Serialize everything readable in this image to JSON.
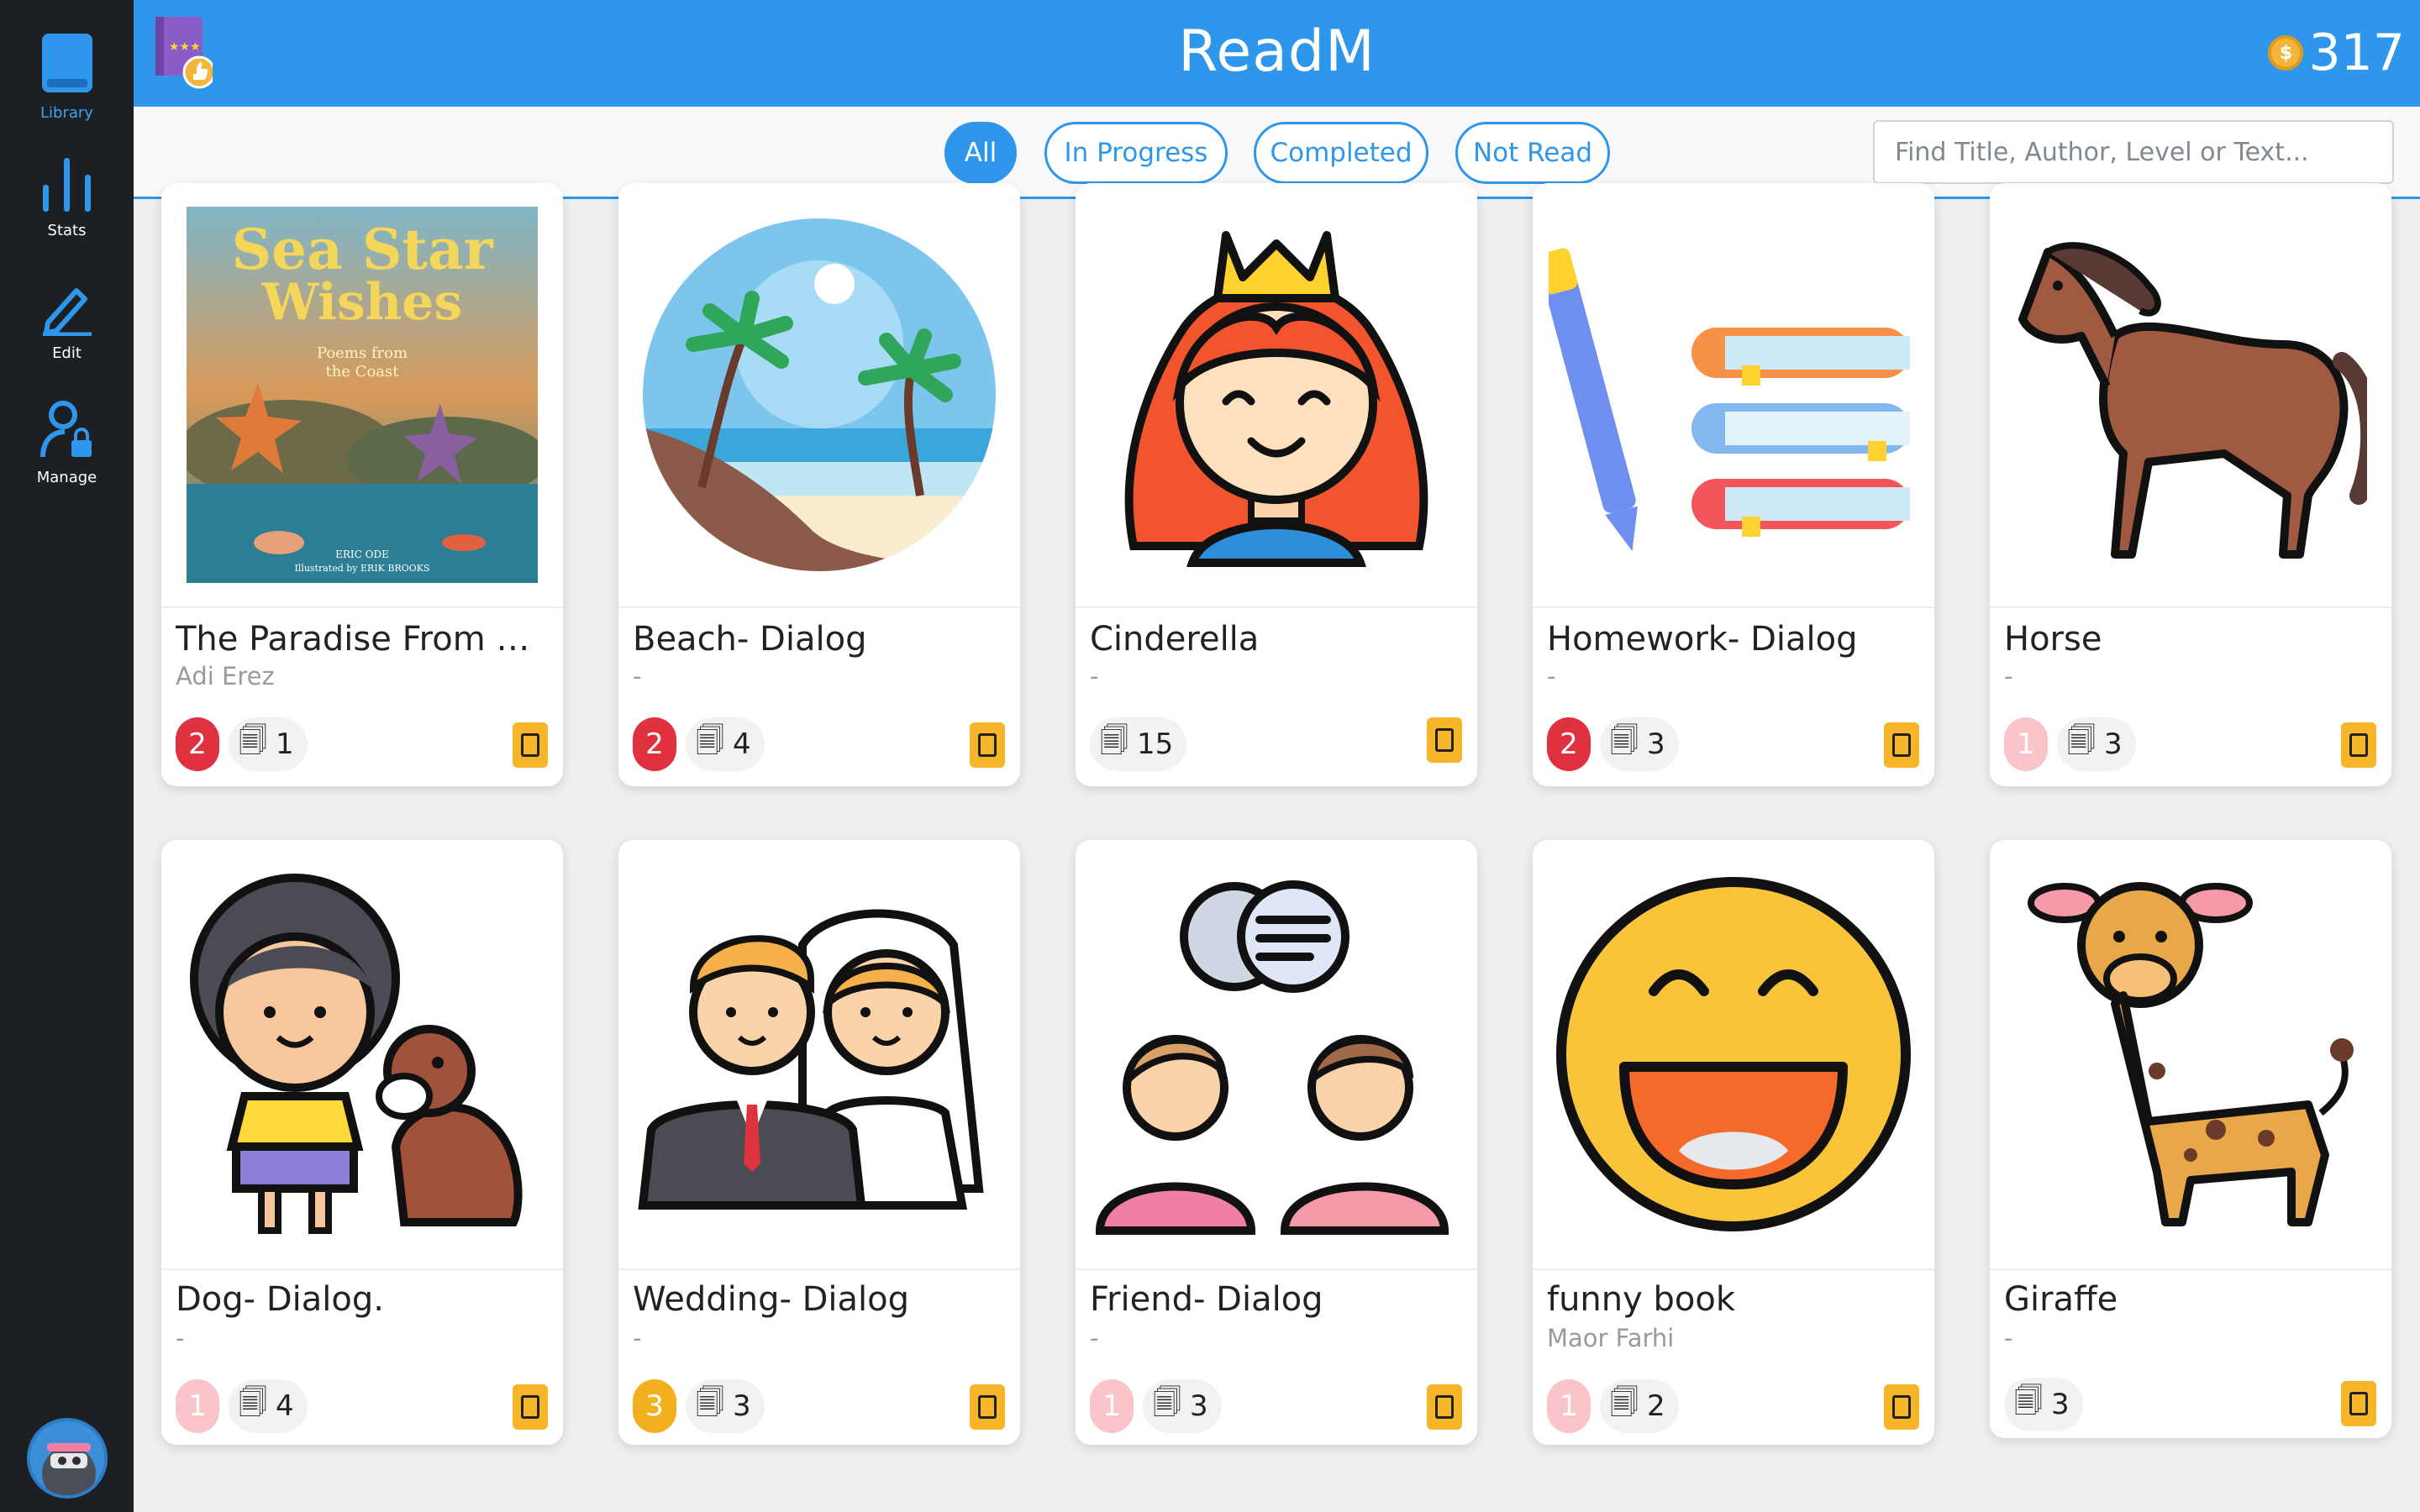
{
  "sidebar": {
    "items": [
      {
        "label": "Library",
        "icon": "book-icon",
        "active": true
      },
      {
        "label": "Stats",
        "icon": "bar-chart-icon",
        "active": false
      },
      {
        "label": "Edit",
        "icon": "pencil-icon",
        "active": false
      },
      {
        "label": "Manage",
        "icon": "user-lock-icon",
        "active": false
      }
    ]
  },
  "header": {
    "title": "ReadM",
    "coins": "317"
  },
  "filters": {
    "tabs": [
      {
        "label": "All",
        "active": true
      },
      {
        "label": "In Progress",
        "active": false
      },
      {
        "label": "Completed",
        "active": false
      },
      {
        "label": "Not Read",
        "active": false
      }
    ],
    "search_placeholder": "Find Title, Author, Level or Text..."
  },
  "books": [
    {
      "title": "The Paradise From No...",
      "author": "Adi Erez",
      "level": "2",
      "level_color": "red",
      "pages": "1",
      "cover": "sea-star-wishes-cover",
      "cover_text_title": "Sea Star Wishes",
      "cover_text_sub": "Poems from the Coast",
      "cover_text_credit": "ERIC ODE",
      "cover_text_illus": "Illustrated by ERIK BROOKS"
    },
    {
      "title": "Beach- Dialog",
      "author": "-",
      "level": "2",
      "level_color": "red",
      "pages": "4",
      "cover": "beach-icon"
    },
    {
      "title": "Cinderella",
      "author": "-",
      "level": "",
      "level_color": "none",
      "pages": "15",
      "cover": "princess-icon"
    },
    {
      "title": "Homework- Dialog",
      "author": "-",
      "level": "2",
      "level_color": "red",
      "pages": "3",
      "cover": "books-pen-icon"
    },
    {
      "title": "Horse",
      "author": "-",
      "level": "1",
      "level_color": "pink",
      "pages": "3",
      "cover": "horse-icon"
    },
    {
      "title": "Dog- Dialog.",
      "author": "-",
      "level": "1",
      "level_color": "pink",
      "pages": "4",
      "cover": "girl-dog-icon"
    },
    {
      "title": "Wedding- Dialog",
      "author": "-",
      "level": "3",
      "level_color": "yellow",
      "pages": "3",
      "cover": "wedding-icon"
    },
    {
      "title": "Friend- Dialog",
      "author": "-",
      "level": "1",
      "level_color": "pink",
      "pages": "3",
      "cover": "friends-chat-icon"
    },
    {
      "title": "funny book",
      "author": "Maor Farhi",
      "level": "1",
      "level_color": "pink",
      "pages": "2",
      "cover": "laughing-face-icon"
    },
    {
      "title": "Giraffe",
      "author": "-",
      "level": "",
      "level_color": "none",
      "pages": "3",
      "cover": "giraffe-icon"
    }
  ]
}
